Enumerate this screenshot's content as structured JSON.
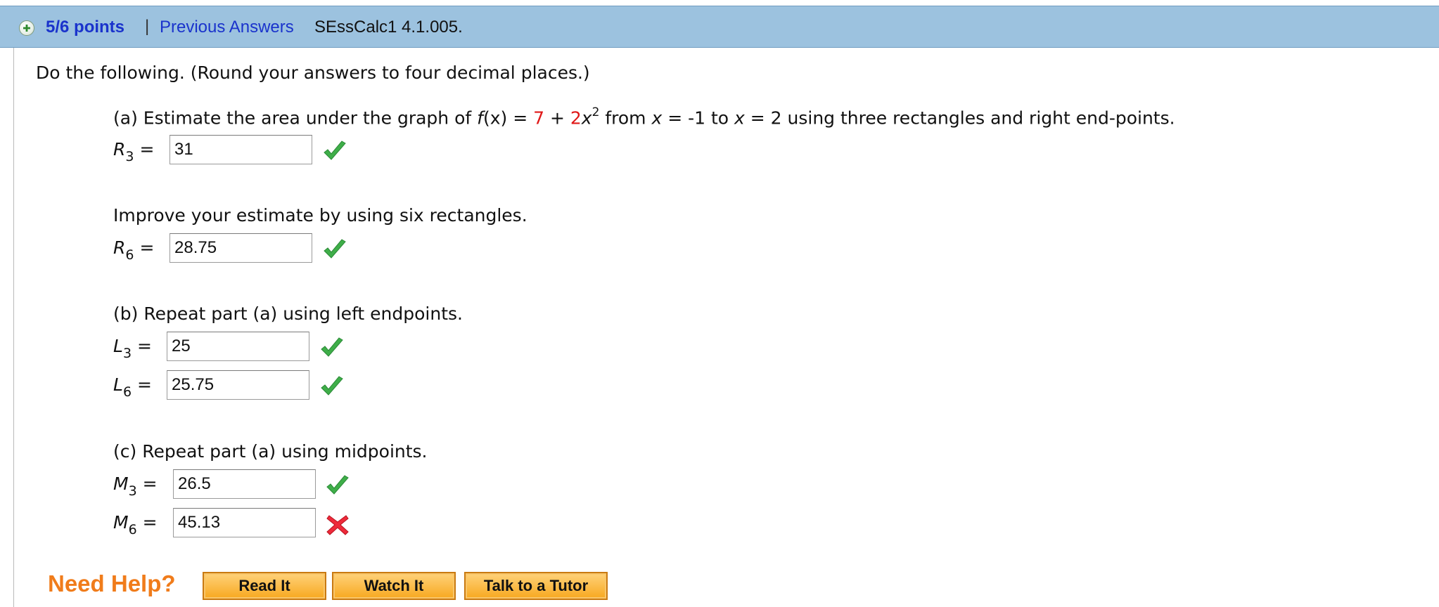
{
  "header": {
    "points": "5/6 points",
    "separator": "|",
    "previous_answers": "Previous Answers",
    "problem_code": "SEssCalc1 4.1.005."
  },
  "instruction": "Do the following. (Round your answers to four decimal places.)",
  "part_a": {
    "text_1": "(a) Estimate the area under the graph of ",
    "func_name": "f",
    "func_arg": "(x)",
    "equals": " = ",
    "coef_const": "7",
    "plus": " + ",
    "coef_x": "2",
    "var": "x",
    "exponent": "2",
    "text_2": " from ",
    "x1_var": "x",
    "x1_rest": " = -1 to ",
    "x2_var": "x",
    "x2_rest": " = 2 using three rectangles and right end-points.",
    "improve_text": "Improve your estimate by using six rectangles."
  },
  "part_b": {
    "text": "(b) Repeat part (a) using left endpoints."
  },
  "part_c": {
    "text": "(c) Repeat part (a) using midpoints."
  },
  "answers": [
    {
      "letter": "R",
      "sub": "3",
      "value": "31",
      "status": "correct"
    },
    {
      "letter": "R",
      "sub": "6",
      "value": "28.75",
      "status": "correct"
    },
    {
      "letter": "L",
      "sub": "3",
      "value": "25",
      "status": "correct"
    },
    {
      "letter": "L",
      "sub": "6",
      "value": "25.75",
      "status": "correct"
    },
    {
      "letter": "M",
      "sub": "3",
      "value": "26.5",
      "status": "correct"
    },
    {
      "letter": "M",
      "sub": "6",
      "value": "45.13",
      "status": "incorrect"
    }
  ],
  "equals_sign": "=",
  "help": {
    "title": "Need Help?",
    "read_it": "Read It",
    "watch_it": "Watch It",
    "talk_to_tutor": "Talk to a Tutor"
  },
  "icons": {
    "expand": "plus-circle-icon",
    "correct": "checkmark-icon",
    "incorrect": "cross-icon"
  },
  "colors": {
    "header_bg": "#9cc2df",
    "link": "#1a33cc",
    "red": "#e01818",
    "help_orange": "#f07c1b",
    "check_green": "#3fae49"
  }
}
